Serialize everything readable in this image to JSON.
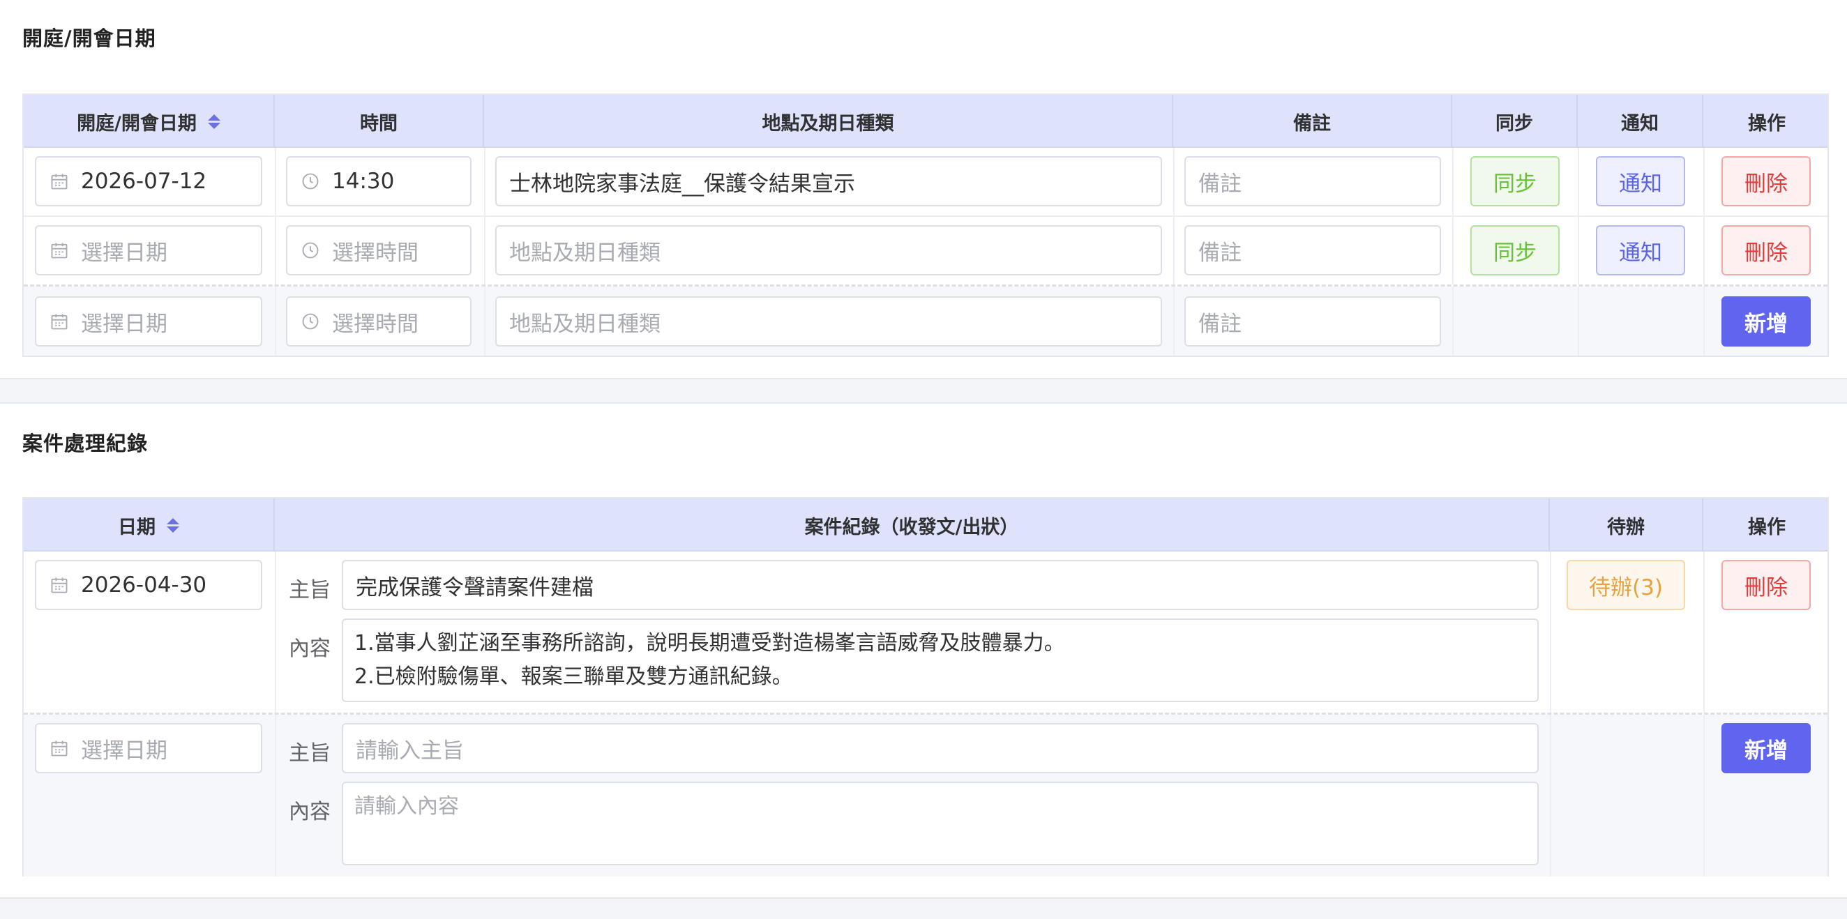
{
  "hearing_section": {
    "title": "開庭/開會日期",
    "headers": {
      "date": "開庭/開會日期",
      "time": "時間",
      "location": "地點及期日種類",
      "remark": "備註",
      "sync": "同步",
      "notify": "通知",
      "action": "操作"
    },
    "rows": [
      {
        "date": "2026-07-12",
        "time": "14:30",
        "location": "士林地院家事法庭__保護令結果宣示",
        "remark_placeholder": "備註",
        "sync_label": "同步",
        "notify_label": "通知",
        "delete_label": "刪除"
      },
      {
        "date_placeholder": "選擇日期",
        "time_placeholder": "選擇時間",
        "location_placeholder": "地點及期日種類",
        "remark_placeholder": "備註",
        "sync_label": "同步",
        "notify_label": "通知",
        "delete_label": "刪除"
      }
    ],
    "new_row": {
      "date_placeholder": "選擇日期",
      "time_placeholder": "選擇時間",
      "location_placeholder": "地點及期日種類",
      "remark_placeholder": "備註",
      "add_label": "新增"
    }
  },
  "record_section": {
    "title": "案件處理紀錄",
    "headers": {
      "date": "日期",
      "record": "案件紀錄（收發文/出狀）",
      "todo": "待辦",
      "action": "操作"
    },
    "rows": [
      {
        "date": "2026-04-30",
        "subject_label": "主旨",
        "subject": "完成保護令聲請案件建檔",
        "content_label": "內容",
        "content": "1.當事人劉芷涵至事務所諮詢，說明長期遭受對造楊峯言語威脅及肢體暴力。\n2.已檢附驗傷單、報案三聯單及雙方通訊紀錄。",
        "todo_label": "待辦(3)",
        "delete_label": "刪除"
      }
    ],
    "new_row": {
      "date_placeholder": "選擇日期",
      "subject_label": "主旨",
      "subject_placeholder": "請輸入主旨",
      "content_label": "內容",
      "content_placeholder": "請輸入內容",
      "add_label": "新增"
    }
  },
  "icons": {
    "date": "calendar-icon",
    "time": "clock-icon",
    "sort": "sort-icon"
  },
  "colors": {
    "header_bg": "#dfe2fb",
    "primary": "#5f65ef",
    "sync": "#67c23a",
    "notify": "#5a63e6",
    "delete": "#e03c3c",
    "todo": "#e6a23c"
  }
}
